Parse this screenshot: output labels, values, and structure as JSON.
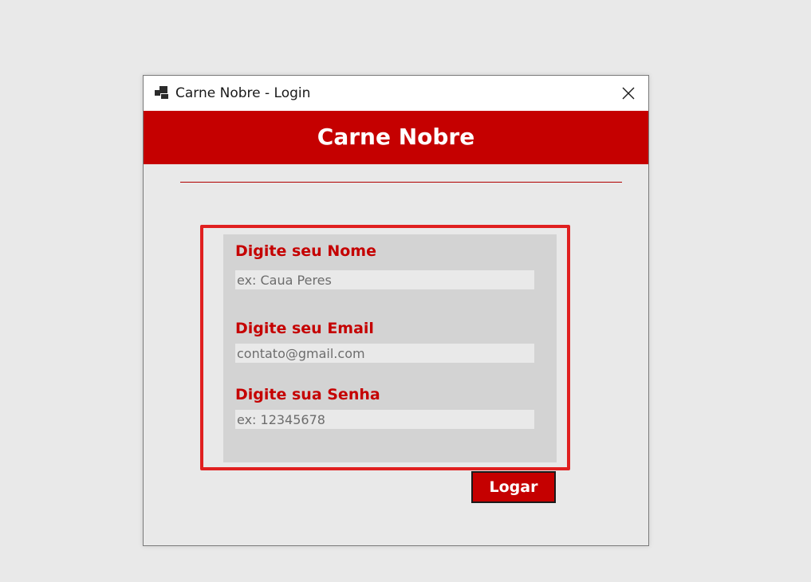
{
  "window": {
    "title": "Carne Nobre - Login"
  },
  "header": {
    "title": "Carne Nobre"
  },
  "form": {
    "name_label": "Digite seu Nome",
    "name_placeholder": "ex: Caua Peres",
    "email_label": "Digite seu Email",
    "email_placeholder": "contato@gmail.com",
    "password_label": "Digite sua Senha",
    "password_placeholder": "ex: 12345678"
  },
  "actions": {
    "login_label": "Logar"
  },
  "icons": {
    "app": "app-window-icon",
    "close": "close-icon"
  },
  "colors": {
    "brand": "#c50000",
    "frame": "#e02020",
    "panel": "#d3d3d3",
    "background": "#e9e9e9"
  }
}
